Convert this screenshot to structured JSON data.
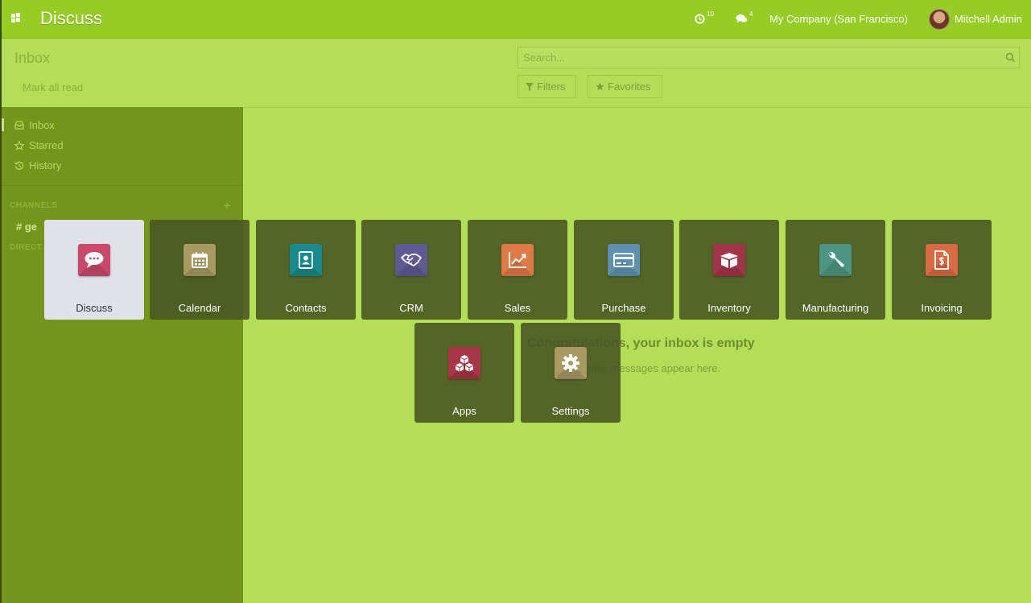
{
  "navbar": {
    "app_name": "Discuss",
    "activity_count": "10",
    "messages_count": "4",
    "company": "My Company (San Francisco)",
    "user": "Mitchell Admin"
  },
  "control_panel": {
    "title": "Inbox",
    "mark_all_read": "Mark all read",
    "search_placeholder": "Search...",
    "filters_label": "Filters",
    "favorites_label": "Favorites"
  },
  "sidebar": {
    "items": [
      {
        "label": "Inbox",
        "icon": "inbox-icon"
      },
      {
        "label": "Starred",
        "icon": "star-icon"
      },
      {
        "label": "History",
        "icon": "history-icon"
      }
    ],
    "channels_header": "CHANNELS",
    "channel_partial": "ge",
    "direct_header_partial": "DIRECT"
  },
  "empty_state": {
    "title": "Congratulations, your inbox is empty",
    "subtitle": "New messages appear here."
  },
  "apps": [
    {
      "label": "Discuss",
      "icon": "chat-bubble-icon",
      "color": "#c9496e",
      "active": true
    },
    {
      "label": "Calendar",
      "icon": "calendar-icon",
      "color": "#a99a63",
      "active": false
    },
    {
      "label": "Contacts",
      "icon": "address-book-icon",
      "color": "#178a89",
      "active": false
    },
    {
      "label": "CRM",
      "icon": "handshake-icon",
      "color": "#5f5a94",
      "active": false
    },
    {
      "label": "Sales",
      "icon": "trend-chart-icon",
      "color": "#de7a46",
      "active": false
    },
    {
      "label": "Purchase",
      "icon": "credit-card-icon",
      "color": "#5e91b0",
      "active": false
    },
    {
      "label": "Inventory",
      "icon": "box-icon",
      "color": "#a3354a",
      "active": false
    },
    {
      "label": "Manufacturing",
      "icon": "wrench-icon",
      "color": "#4e9482",
      "active": false
    },
    {
      "label": "Invoicing",
      "icon": "invoice-icon",
      "color": "#d96a43",
      "active": false
    },
    {
      "label": "Apps",
      "icon": "cubes-icon",
      "color": "#a83646",
      "active": false
    },
    {
      "label": "Settings",
      "icon": "gear-icon",
      "color": "#a99a63",
      "active": false
    }
  ]
}
